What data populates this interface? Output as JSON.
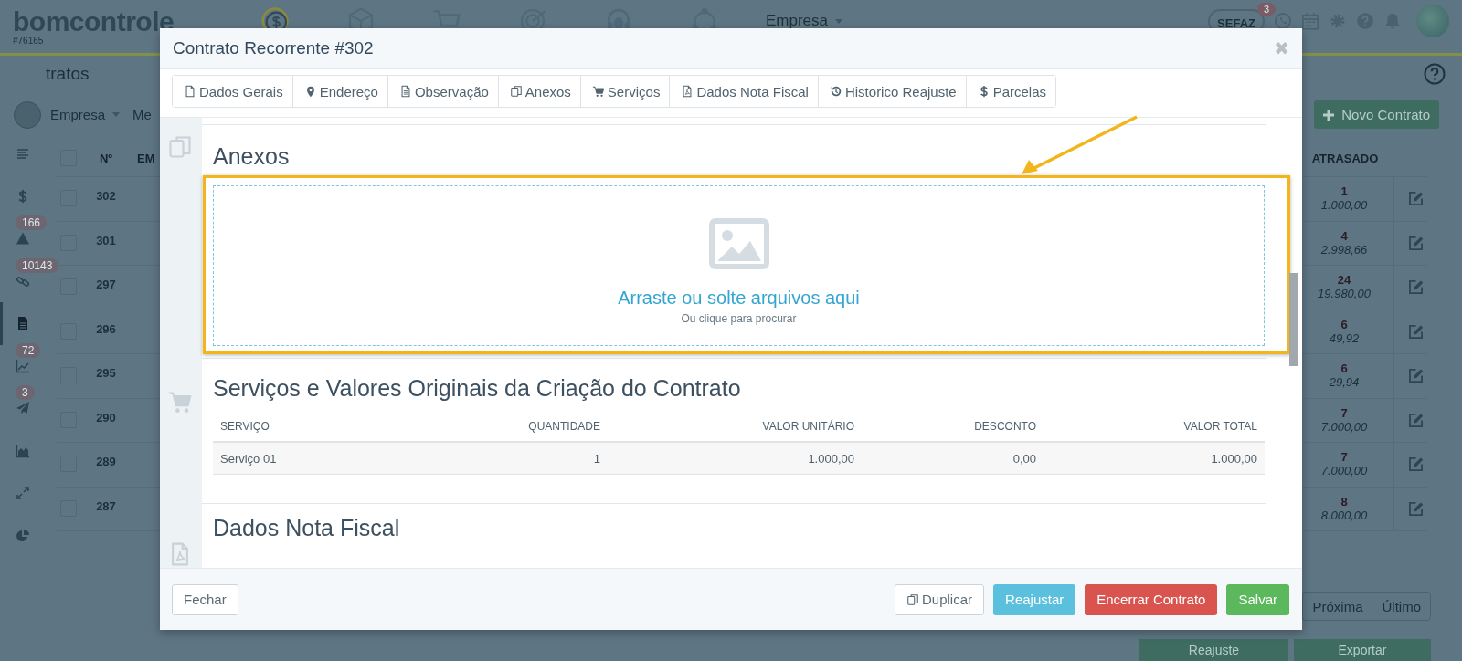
{
  "app": {
    "logo": "bomcontrole",
    "account": "#76165",
    "company_menu": "Empresa",
    "sefaz_label": "SEFAZ",
    "sefaz_badge": "3",
    "page_title": "tratos",
    "filters": [
      "Empresa",
      "Me"
    ],
    "new_button": "Novo Contrato",
    "sidebar": [
      {
        "selected": false
      },
      {
        "selected": false
      },
      {
        "selected": false,
        "badge": "166"
      },
      {
        "selected": false,
        "badge": "10143"
      },
      {
        "selected": true
      },
      {
        "selected": false,
        "badge": "72"
      },
      {
        "selected": false,
        "badge": "3"
      },
      {
        "selected": false
      },
      {
        "selected": false
      },
      {
        "selected": false
      }
    ],
    "table": {
      "columns": [
        "Nº",
        "EM",
        "ATRASADO"
      ],
      "all_checked": false,
      "rows": [
        {
          "checked": false,
          "number": "302",
          "overdue_count": "1",
          "overdue_value": "1.000,00"
        },
        {
          "checked": false,
          "number": "301",
          "overdue_count": "4",
          "overdue_value": "2.998,66"
        },
        {
          "checked": false,
          "number": "297",
          "overdue_count": "24",
          "overdue_value": "19.980,00"
        },
        {
          "checked": false,
          "number": "296",
          "overdue_count": "6",
          "overdue_value": "49,92"
        },
        {
          "checked": false,
          "number": "295",
          "overdue_count": "6",
          "overdue_value": "29,94"
        },
        {
          "checked": false,
          "number": "290",
          "overdue_count": "7",
          "overdue_value": "7.000,00"
        },
        {
          "checked": false,
          "number": "289",
          "overdue_count": "7",
          "overdue_value": "7.000,00"
        },
        {
          "checked": false,
          "number": "287",
          "overdue_count": "8",
          "overdue_value": "8.000,00"
        }
      ]
    },
    "pagination": [
      "Próxima",
      "Último"
    ],
    "actions": [
      "Reajuste",
      "Exportar"
    ]
  },
  "modal": {
    "title": "Contrato Recorrente #302",
    "close": "✖",
    "tabs": [
      {
        "label": "Dados Gerais",
        "selected": false
      },
      {
        "label": "Endereço",
        "selected": false
      },
      {
        "label": "Observação",
        "selected": false
      },
      {
        "label": "Anexos",
        "selected": false
      },
      {
        "label": "Serviços",
        "selected": false
      },
      {
        "label": "Dados Nota Fiscal",
        "selected": false
      },
      {
        "label": "Historico Reajuste",
        "selected": false
      },
      {
        "label": "Parcelas",
        "selected": false
      }
    ],
    "attachments": {
      "title": "Anexos",
      "drop_text": "Arraste ou solte arquivos aqui",
      "drop_hint": "Ou clique para procurar"
    },
    "services": {
      "title": "Serviços e Valores Originais da Criação do Contrato",
      "columns": [
        "SERVIÇO",
        "QUANTIDADE",
        "VALOR UNITÁRIO",
        "DESCONTO",
        "VALOR TOTAL"
      ],
      "rows": [
        [
          "Serviço 01",
          "1",
          "1.000,00",
          "0,00",
          "1.000,00"
        ]
      ]
    },
    "invoice": {
      "title": "Dados Nota Fiscal"
    },
    "close_button": "Fechar",
    "buttons": [
      {
        "label": "Duplicar",
        "kind": "duplicate"
      },
      {
        "label": "Reajustar",
        "kind": "info"
      },
      {
        "label": "Encerrar Contrato",
        "kind": "danger"
      },
      {
        "label": "Salvar",
        "kind": "success"
      }
    ]
  }
}
